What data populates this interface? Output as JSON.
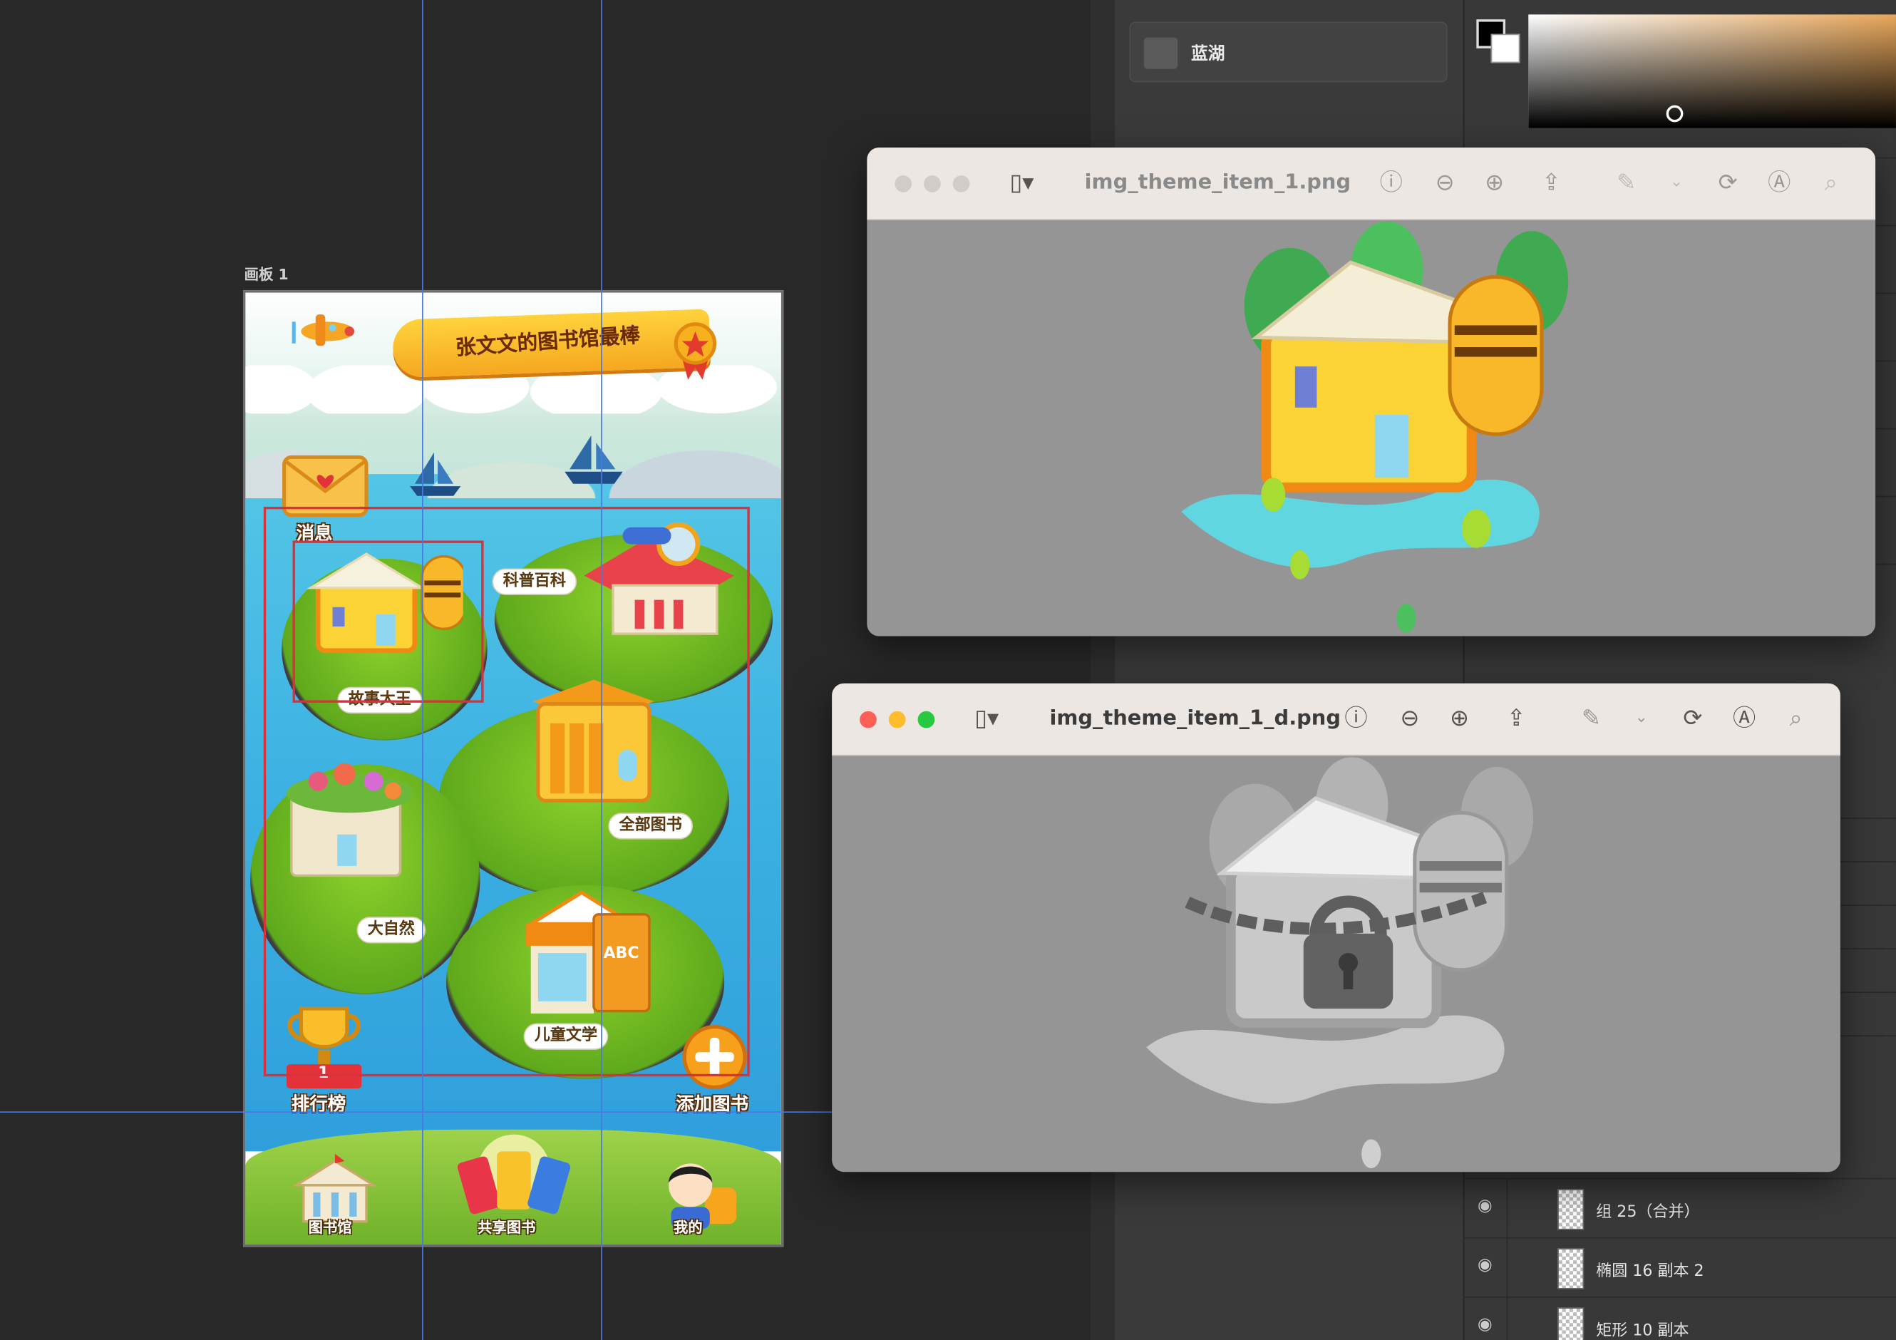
{
  "artboard": {
    "label": "画板 1",
    "banner_title": "张文文的图书馆最棒",
    "messages_label": "消息",
    "islands": {
      "science": "科普百科",
      "story": "故事大王",
      "all_books": "全部图书",
      "nature": "大自然",
      "children_lit": "儿童文学"
    },
    "leaderboard_label": "排行榜",
    "leaderboard_rank": "1",
    "add_book_label": "添加图书",
    "nav": {
      "library": "图书馆",
      "share": "共享图书",
      "mine": "我的"
    }
  },
  "library_panel": {
    "item_label": "蓝湖"
  },
  "layers": [
    {
      "name": "组 25（合并）"
    },
    {
      "name": "椭圆 16 副本 2"
    },
    {
      "name": "矩形 10 副本"
    }
  ],
  "preview_windows": [
    {
      "title": "img_theme_item_1.png",
      "active": false
    },
    {
      "title": "img_theme_item_1_d.png",
      "active": true
    }
  ],
  "colors": {
    "guide": "#4a78e0",
    "selection": "#d8323c",
    "traffic_red": "#fe5f57",
    "traffic_yellow": "#febc2e",
    "traffic_green": "#28c840"
  }
}
